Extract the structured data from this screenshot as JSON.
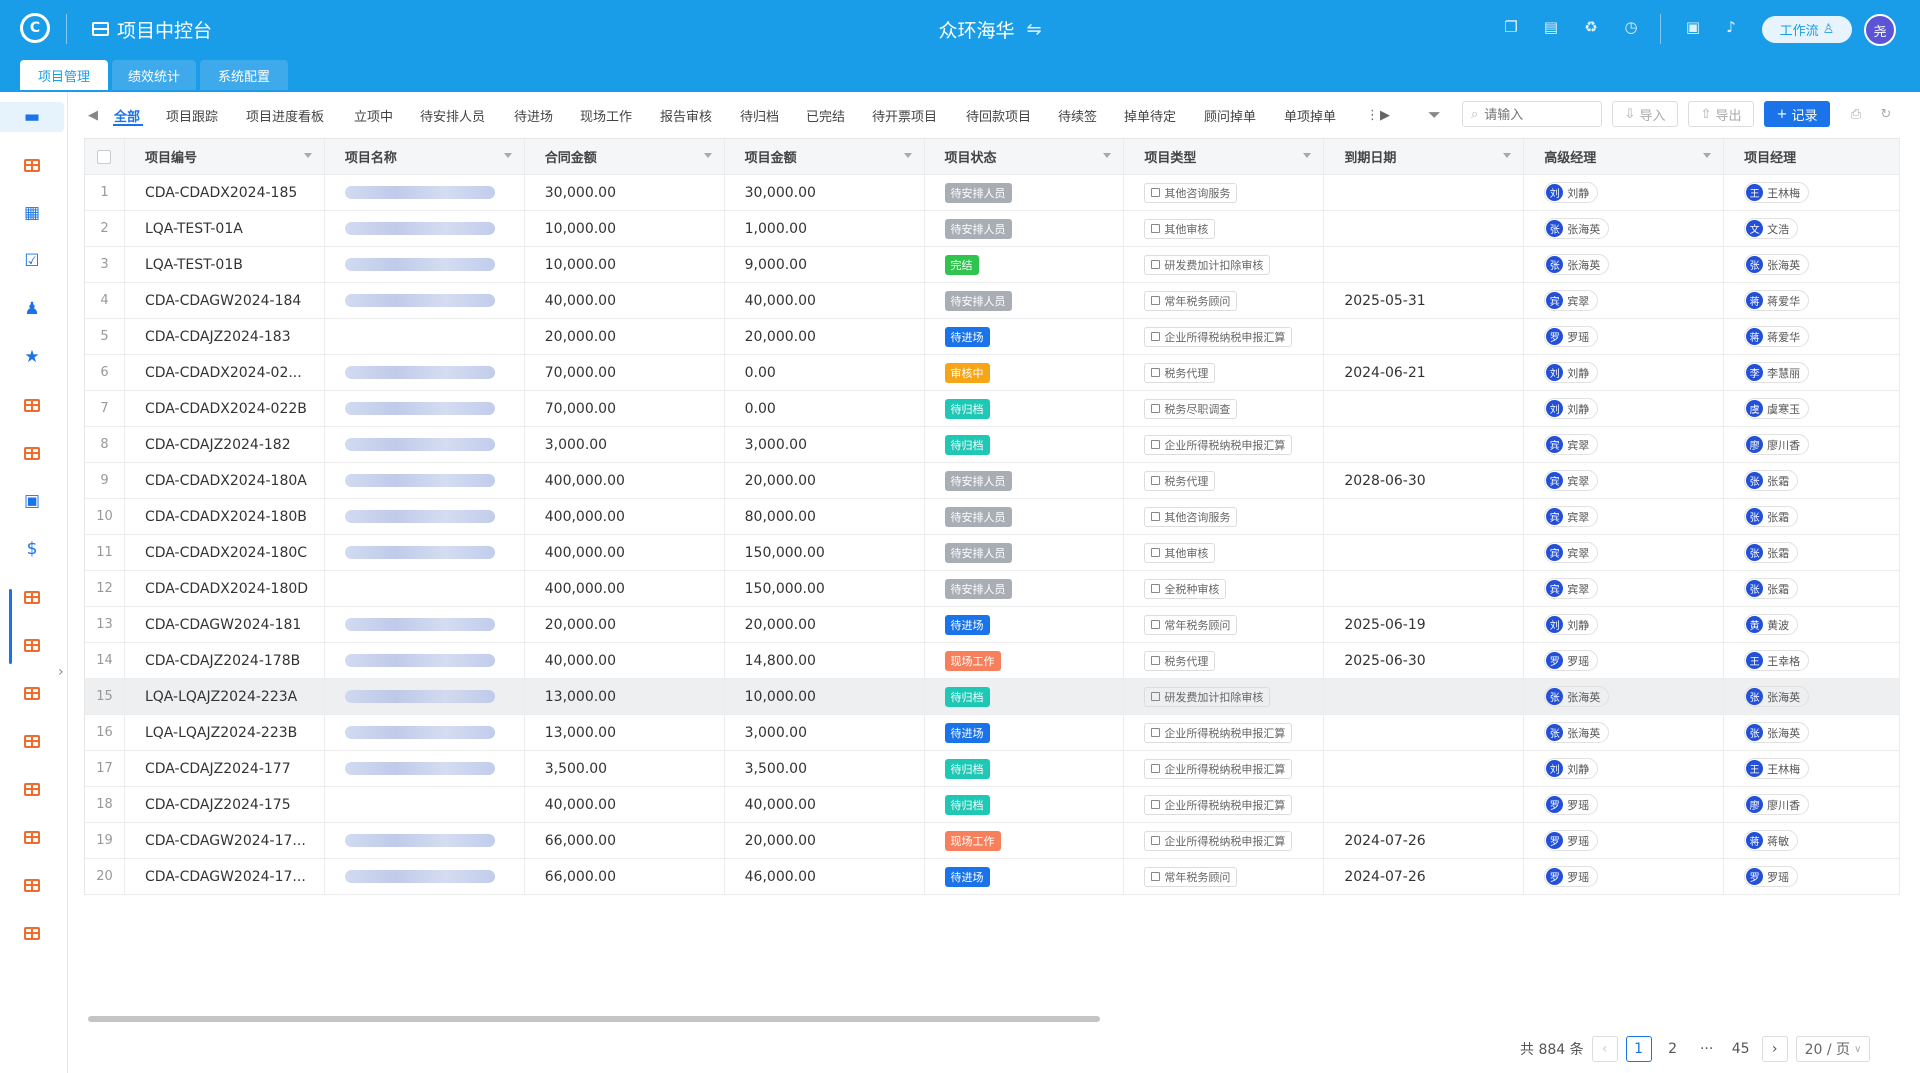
{
  "app": {
    "logo_glyph": "C",
    "title": "项目中控台",
    "center_title": "众环海华",
    "switch_glyph": "⇋",
    "workflow_label": "工作流",
    "avatar_text": "尧",
    "header_icons": [
      "clipboard-icon",
      "document-icon",
      "recycle-icon",
      "clock-icon",
      "task-icon",
      "bell-icon"
    ]
  },
  "main_tabs": [
    "项目管理",
    "绩效统计",
    "系统配置"
  ],
  "filter_tabs": [
    "全部",
    "项目跟踪",
    "项目进度看板",
    "立项中",
    "待安排人员",
    "待进场",
    "现场工作",
    "报告审核",
    "待归档",
    "已完结",
    "待开票项目",
    "待回款项目",
    "待续签",
    "掉单待定",
    "顾问掉单",
    "单项掉单"
  ],
  "toolbar": {
    "search_placeholder": "请输入",
    "import_label": "导入",
    "export_label": "导出",
    "add_label": "记录"
  },
  "status_colors": {
    "待安排人员": "#a9aeb5",
    "完结": "#2ec44d",
    "待进场": "#1a73e8",
    "审核中": "#f5a516",
    "待归档": "#1ec8b5",
    "现场工作": "#f7805c"
  },
  "table": {
    "columns": [
      "项目编号",
      "项目名称",
      "合同金额",
      "项目金额",
      "项目状态",
      "项目类型",
      "到期日期",
      "高级经理",
      "项目经理"
    ],
    "rows": [
      {
        "no": "1",
        "code": "CDA-CDADX2024-185",
        "has_name": true,
        "contract": "30,000.00",
        "amount": "30,000.00",
        "status": "待安排人员",
        "type": "其他咨询服务",
        "due": "",
        "sm": "刘静",
        "sm_av": "刘",
        "pm": "王林梅",
        "pm_av": "王"
      },
      {
        "no": "2",
        "code": "LQA-TEST-01A",
        "has_name": true,
        "contract": "10,000.00",
        "amount": "1,000.00",
        "status": "待安排人员",
        "type": "其他审核",
        "due": "",
        "sm": "张海英",
        "sm_av": "张",
        "pm": "文浩",
        "pm_av": "文"
      },
      {
        "no": "3",
        "code": "LQA-TEST-01B",
        "has_name": true,
        "contract": "10,000.00",
        "amount": "9,000.00",
        "status": "完结",
        "type": "研发费加计扣除审核",
        "due": "",
        "sm": "张海英",
        "sm_av": "张",
        "pm": "张海英",
        "pm_av": "张"
      },
      {
        "no": "4",
        "code": "CDA-CDAGW2024-184",
        "has_name": true,
        "contract": "40,000.00",
        "amount": "40,000.00",
        "status": "待安排人员",
        "type": "常年税务顾问",
        "due": "2025-05-31",
        "sm": "宾翠",
        "sm_av": "宾",
        "pm": "蒋爱华",
        "pm_av": "蒋"
      },
      {
        "no": "5",
        "code": "CDA-CDAJZ2024-183",
        "has_name": false,
        "contract": "20,000.00",
        "amount": "20,000.00",
        "status": "待进场",
        "type": "企业所得税纳税申报汇算",
        "due": "",
        "sm": "罗瑶",
        "sm_av": "罗",
        "pm": "蒋爱华",
        "pm_av": "蒋"
      },
      {
        "no": "6",
        "code": "CDA-CDADX2024-02...",
        "has_name": true,
        "contract": "70,000.00",
        "amount": "0.00",
        "status": "审核中",
        "type": "税务代理",
        "due": "2024-06-21",
        "sm": "刘静",
        "sm_av": "刘",
        "pm": "李慧丽",
        "pm_av": "李"
      },
      {
        "no": "7",
        "code": "CDA-CDADX2024-022B",
        "has_name": true,
        "contract": "70,000.00",
        "amount": "0.00",
        "status": "待归档",
        "type": "税务尽职调查",
        "due": "",
        "sm": "刘静",
        "sm_av": "刘",
        "pm": "虞寒玉",
        "pm_av": "虞"
      },
      {
        "no": "8",
        "code": "CDA-CDAJZ2024-182",
        "has_name": true,
        "contract": "3,000.00",
        "amount": "3,000.00",
        "status": "待归档",
        "type": "企业所得税纳税申报汇算",
        "due": "",
        "sm": "宾翠",
        "sm_av": "宾",
        "pm": "廖川香",
        "pm_av": "廖"
      },
      {
        "no": "9",
        "code": "CDA-CDADX2024-180A",
        "has_name": true,
        "contract": "400,000.00",
        "amount": "20,000.00",
        "status": "待安排人员",
        "type": "税务代理",
        "due": "2028-06-30",
        "sm": "宾翠",
        "sm_av": "宾",
        "pm": "张霜",
        "pm_av": "张"
      },
      {
        "no": "10",
        "code": "CDA-CDADX2024-180B",
        "has_name": true,
        "contract": "400,000.00",
        "amount": "80,000.00",
        "status": "待安排人员",
        "type": "其他咨询服务",
        "due": "",
        "sm": "宾翠",
        "sm_av": "宾",
        "pm": "张霜",
        "pm_av": "张"
      },
      {
        "no": "11",
        "code": "CDA-CDADX2024-180C",
        "has_name": true,
        "contract": "400,000.00",
        "amount": "150,000.00",
        "status": "待安排人员",
        "type": "其他审核",
        "due": "",
        "sm": "宾翠",
        "sm_av": "宾",
        "pm": "张霜",
        "pm_av": "张"
      },
      {
        "no": "12",
        "code": "CDA-CDADX2024-180D",
        "has_name": false,
        "contract": "400,000.00",
        "amount": "150,000.00",
        "status": "待安排人员",
        "type": "全税种审核",
        "due": "",
        "sm": "宾翠",
        "sm_av": "宾",
        "pm": "张霜",
        "pm_av": "张"
      },
      {
        "no": "13",
        "code": "CDA-CDAGW2024-181",
        "has_name": true,
        "contract": "20,000.00",
        "amount": "20,000.00",
        "status": "待进场",
        "type": "常年税务顾问",
        "due": "2025-06-19",
        "sm": "刘静",
        "sm_av": "刘",
        "pm": "黄波",
        "pm_av": "黄"
      },
      {
        "no": "14",
        "code": "CDA-CDAJZ2024-178B",
        "has_name": true,
        "contract": "40,000.00",
        "amount": "14,800.00",
        "status": "现场工作",
        "type": "税务代理",
        "due": "2025-06-30",
        "sm": "罗瑶",
        "sm_av": "罗",
        "pm": "王幸格",
        "pm_av": "王"
      },
      {
        "no": "15",
        "code": "LQA-LQAJZ2024-223A",
        "has_name": true,
        "contract": "13,000.00",
        "amount": "10,000.00",
        "status": "待归档",
        "type": "研发费加计扣除审核",
        "due": "",
        "sm": "张海英",
        "sm_av": "张",
        "pm": "张海英",
        "pm_av": "张"
      },
      {
        "no": "16",
        "code": "LQA-LQAJZ2024-223B",
        "has_name": true,
        "contract": "13,000.00",
        "amount": "3,000.00",
        "status": "待进场",
        "type": "企业所得税纳税申报汇算",
        "due": "",
        "sm": "张海英",
        "sm_av": "张",
        "pm": "张海英",
        "pm_av": "张"
      },
      {
        "no": "17",
        "code": "CDA-CDAJZ2024-177",
        "has_name": true,
        "contract": "3,500.00",
        "amount": "3,500.00",
        "status": "待归档",
        "type": "企业所得税纳税申报汇算",
        "due": "",
        "sm": "刘静",
        "sm_av": "刘",
        "pm": "王林梅",
        "pm_av": "王"
      },
      {
        "no": "18",
        "code": "CDA-CDAJZ2024-175",
        "has_name": false,
        "contract": "40,000.00",
        "amount": "40,000.00",
        "status": "待归档",
        "type": "企业所得税纳税申报汇算",
        "due": "",
        "sm": "罗瑶",
        "sm_av": "罗",
        "pm": "廖川香",
        "pm_av": "廖"
      },
      {
        "no": "19",
        "code": "CDA-CDAGW2024-17...",
        "has_name": true,
        "contract": "66,000.00",
        "amount": "20,000.00",
        "status": "现场工作",
        "type": "企业所得税纳税申报汇算",
        "due": "2024-07-26",
        "sm": "罗瑶",
        "sm_av": "罗",
        "pm": "蒋敏",
        "pm_av": "蒋"
      },
      {
        "no": "20",
        "code": "CDA-CDAGW2024-17...",
        "has_name": true,
        "contract": "66,000.00",
        "amount": "46,000.00",
        "status": "待进场",
        "type": "常年税务顾问",
        "due": "2024-07-26",
        "sm": "罗瑶",
        "sm_av": "罗",
        "pm": "罗瑶",
        "pm_av": "罗"
      }
    ]
  },
  "pagination": {
    "total_label": "共 884 条",
    "pages": [
      "1",
      "2",
      "···",
      "45"
    ],
    "current": "1",
    "page_size": "20 / 页"
  },
  "sidebar_icons": [
    "briefcase-icon",
    "table-icon",
    "calendar-icon",
    "task-check-icon",
    "users-icon",
    "star-icon",
    "table-icon",
    "table-icon",
    "card-icon",
    "dollar-icon",
    "table-icon",
    "table-icon",
    "table-icon",
    "table-icon",
    "table-icon",
    "table-icon",
    "table-icon",
    "table-icon"
  ]
}
